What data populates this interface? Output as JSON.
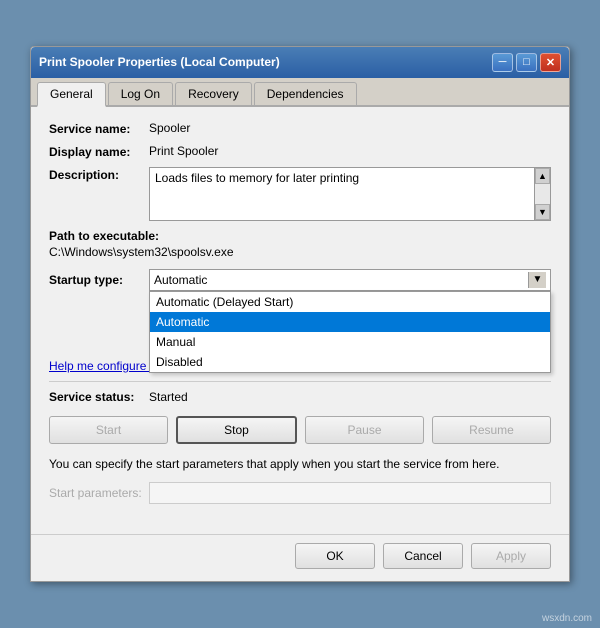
{
  "window": {
    "title": "Print Spooler Properties (Local Computer)",
    "close_btn": "✕",
    "min_btn": "─",
    "max_btn": "□"
  },
  "tabs": [
    {
      "label": "General",
      "active": true
    },
    {
      "label": "Log On",
      "active": false
    },
    {
      "label": "Recovery",
      "active": false
    },
    {
      "label": "Dependencies",
      "active": false
    }
  ],
  "fields": {
    "service_name_label": "Service name:",
    "service_name_value": "Spooler",
    "display_name_label": "Display name:",
    "display_name_value": "Print Spooler",
    "description_label": "Description:",
    "description_value": "Loads files to memory for later printing",
    "path_label": "Path to executable:",
    "path_value": "C:\\Windows\\system32\\spoolsv.exe",
    "startup_label": "Startup type:",
    "startup_value": "Automatic",
    "help_link": "Help me configure s...",
    "status_label": "Service status:",
    "status_value": "Started"
  },
  "dropdown": {
    "options": [
      {
        "label": "Automatic (Delayed Start)",
        "selected": false
      },
      {
        "label": "Automatic",
        "selected": true
      },
      {
        "label": "Manual",
        "selected": false
      },
      {
        "label": "Disabled",
        "selected": false
      }
    ]
  },
  "service_buttons": {
    "start": "Start",
    "stop": "Stop",
    "pause": "Pause",
    "resume": "Resume"
  },
  "info_text": "You can specify the start parameters that apply when you start the service from here.",
  "params_label": "Start parameters:",
  "bottom_buttons": {
    "ok": "OK",
    "cancel": "Cancel",
    "apply": "Apply"
  },
  "watermark": "wsxdn.com"
}
